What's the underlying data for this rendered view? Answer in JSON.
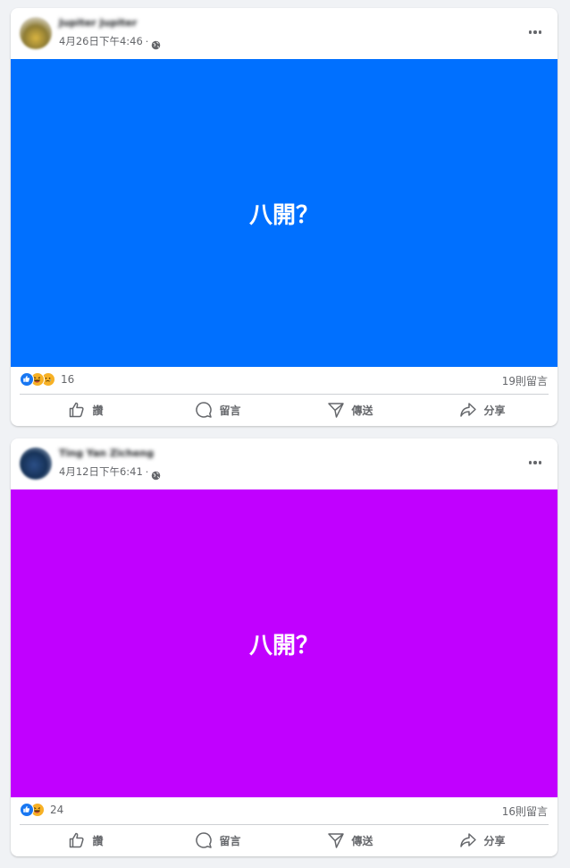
{
  "colors": {
    "post1_background": "#0070ff",
    "post2_background": "#c100ff",
    "like_blue": "#1877f2",
    "emoji_yellow": "#f7b125",
    "secondary_text": "#65676b"
  },
  "posts": [
    {
      "author": "Jupiter Jupiter",
      "timestamp": "4月26日下午4:46",
      "separator": "·",
      "audience_icon": "globe-icon",
      "image_text": "八開？",
      "reactions": [
        "like",
        "haha",
        "sad"
      ],
      "reaction_count": "16",
      "comment_count": "19則留言"
    },
    {
      "author": "Ting Yan Zicheng",
      "timestamp": "4月12日下午6:41",
      "separator": "·",
      "audience_icon": "globe-icon",
      "image_text": "八開？",
      "reactions": [
        "like",
        "haha"
      ],
      "reaction_count": "24",
      "comment_count": "16則留言"
    }
  ],
  "actions": {
    "like": "讚",
    "comment": "留言",
    "send": "傳送",
    "share": "分享"
  }
}
